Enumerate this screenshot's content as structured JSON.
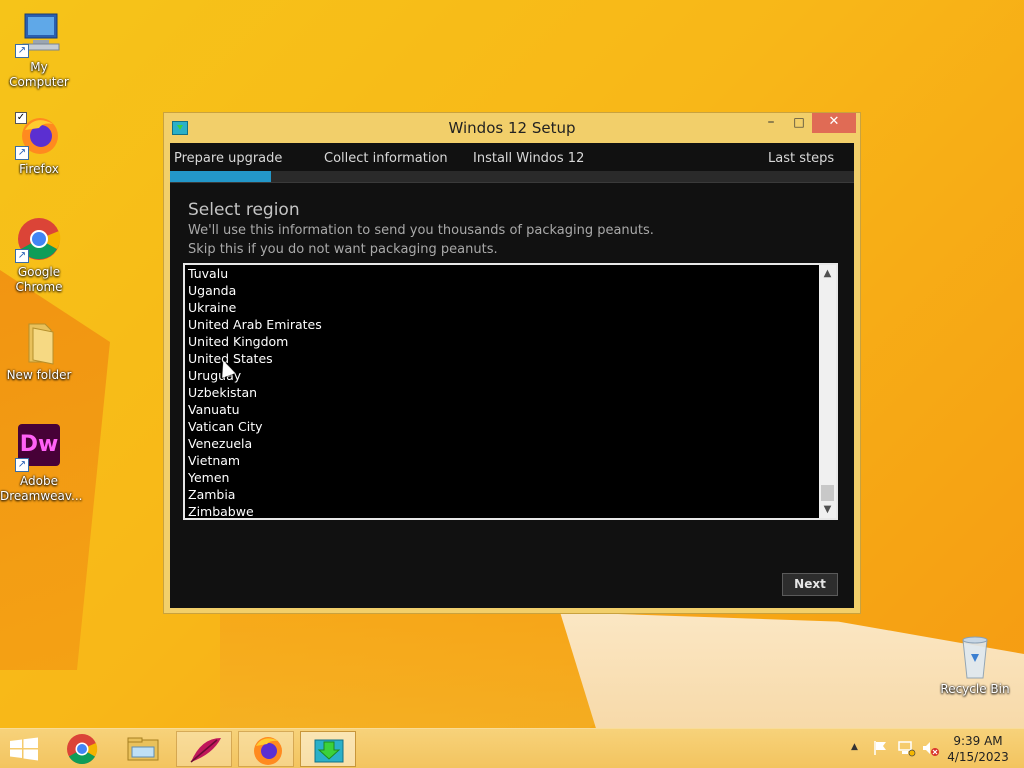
{
  "desktop": {
    "icons": [
      {
        "label": "My Computer",
        "icon": "computer-icon"
      },
      {
        "label": "Firefox",
        "icon": "firefox-icon"
      },
      {
        "label": "Google Chrome",
        "icon": "chrome-icon"
      },
      {
        "label": "New folder",
        "icon": "folder-icon"
      },
      {
        "label": "Adobe Dreamweav...",
        "icon": "dreamweaver-icon",
        "glyph": "Dw"
      },
      {
        "label": "Recycle Bin",
        "icon": "recycle-bin-icon"
      }
    ]
  },
  "window": {
    "title": "Windos 12 Setup",
    "controls": {
      "minimize": "–",
      "maximize": "□",
      "close": "✕"
    },
    "steps": [
      "Prepare upgrade",
      "Collect information",
      "Install Windos 12",
      "Last steps"
    ],
    "progress_fraction": 0.147,
    "heading": "Select region",
    "description_line1": "We'll use this information to send you thousands of packaging peanuts.",
    "description_line2": "Skip this if you do not want packaging peanuts.",
    "regions": [
      "Tuvalu",
      "Uganda",
      "Ukraine",
      "United Arab Emirates",
      "United Kingdom",
      "United States",
      "Uruguay",
      "Uzbekistan",
      "Vanuatu",
      "Vatican City",
      "Venezuela",
      "Vietnam",
      "Yemen",
      "Zambia",
      "Zimbabwe"
    ],
    "scroll_up": "▲",
    "scroll_down": "▼",
    "next_label": "Next"
  },
  "taskbar": {
    "items": [
      "start-button",
      "chrome-icon",
      "file-explorer-icon",
      "feather-app-icon",
      "firefox-icon",
      "setup-icon"
    ],
    "clock_time": "9:39 AM",
    "clock_date": "4/15/2023",
    "tray_expand": "▲"
  },
  "colors": {
    "accent": "#2397c9",
    "window_frame": "#f2cf6a",
    "close_button": "#e06b55",
    "client_bg": "#111111"
  }
}
